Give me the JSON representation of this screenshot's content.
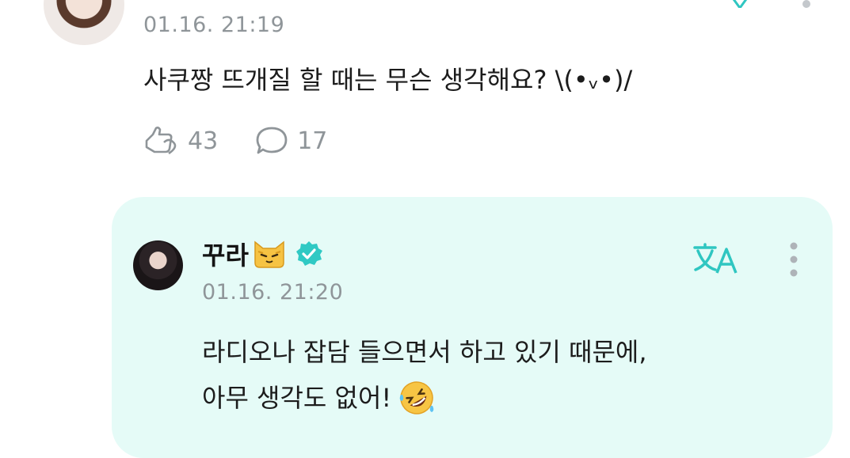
{
  "post": {
    "time": "01.16. 21:19",
    "text": "사쿠짱 뜨개질 할 때는 무슨 생각해요? \\(•ᵥ•)/",
    "actions": {
      "likes": "43",
      "comments": "17"
    }
  },
  "reply": {
    "author": "꾸라",
    "time": "01.16. 21:20",
    "line1": "라디오나 잡담 들으면서 하고 있기 때문에,",
    "line2": "아무 생각도 없어!"
  },
  "icons": {
    "like": "like-icon",
    "comment": "comment-icon",
    "translate": "translate-icon",
    "more": "more-vertical-icon",
    "verified": "verified-badge-icon",
    "cat": "cat-emoji",
    "rofl": "rolling-laughing-emoji"
  },
  "colors": {
    "accent": "#2fc6c1",
    "card_bg": "#e5fbf7",
    "muted": "#8f9599"
  }
}
